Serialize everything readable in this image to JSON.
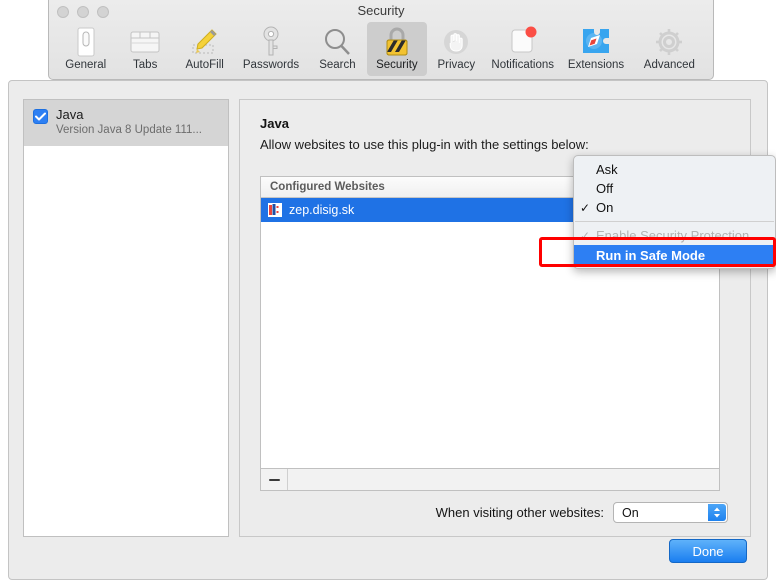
{
  "window": {
    "title": "Security",
    "traffic_lights": [
      "close",
      "minimize",
      "zoom"
    ]
  },
  "toolbar": {
    "tabs": [
      {
        "label": "General",
        "icon": "general-icon",
        "selected": false
      },
      {
        "label": "Tabs",
        "icon": "tabs-icon",
        "selected": false
      },
      {
        "label": "AutoFill",
        "icon": "autofill-icon",
        "selected": false
      },
      {
        "label": "Passwords",
        "icon": "passwords-key-icon",
        "selected": false
      },
      {
        "label": "Search",
        "icon": "search-icon",
        "selected": false
      },
      {
        "label": "Security",
        "icon": "security-lock-icon",
        "selected": true
      },
      {
        "label": "Privacy",
        "icon": "privacy-hand-icon",
        "selected": false
      },
      {
        "label": "Notifications",
        "icon": "notifications-icon",
        "selected": false
      },
      {
        "label": "Extensions",
        "icon": "extensions-icon",
        "selected": false
      },
      {
        "label": "Advanced",
        "icon": "advanced-gear-icon",
        "selected": false
      }
    ]
  },
  "sidebar": {
    "plugins": [
      {
        "name": "Java",
        "version": "Version Java 8 Update 111...",
        "enabled": true,
        "selected": true
      }
    ]
  },
  "detail": {
    "title": "Java",
    "subtitle": "Allow websites to use this plug-in with the settings below:",
    "list_header": "Configured Websites",
    "sites": [
      {
        "name": "zep.disig.sk",
        "icon": "disig-favicon",
        "selected": true
      }
    ],
    "remove_button": "—",
    "other_websites_label": "When visiting other websites:",
    "other_websites_value": "On"
  },
  "menu": {
    "items": [
      {
        "label": "Ask",
        "checked": false,
        "disabled": false,
        "highlighted": false
      },
      {
        "label": "Off",
        "checked": false,
        "disabled": false,
        "highlighted": false
      },
      {
        "label": "On",
        "checked": true,
        "disabled": false,
        "highlighted": false
      },
      {
        "separator": true
      },
      {
        "label": "Enable Security Protection",
        "checked": true,
        "disabled": true,
        "highlighted": false
      },
      {
        "label": "Run in Safe Mode",
        "checked": false,
        "disabled": false,
        "highlighted": true
      }
    ],
    "checkmark": "✓"
  },
  "footer": {
    "done_label": "Done"
  },
  "colors": {
    "accent_blue": "#2d7ff3",
    "selection_blue": "#1f72e5",
    "annotation_red": "#ff0000",
    "window_bg": "#ececec",
    "selected_tab_bg": "#cdcdcd"
  }
}
